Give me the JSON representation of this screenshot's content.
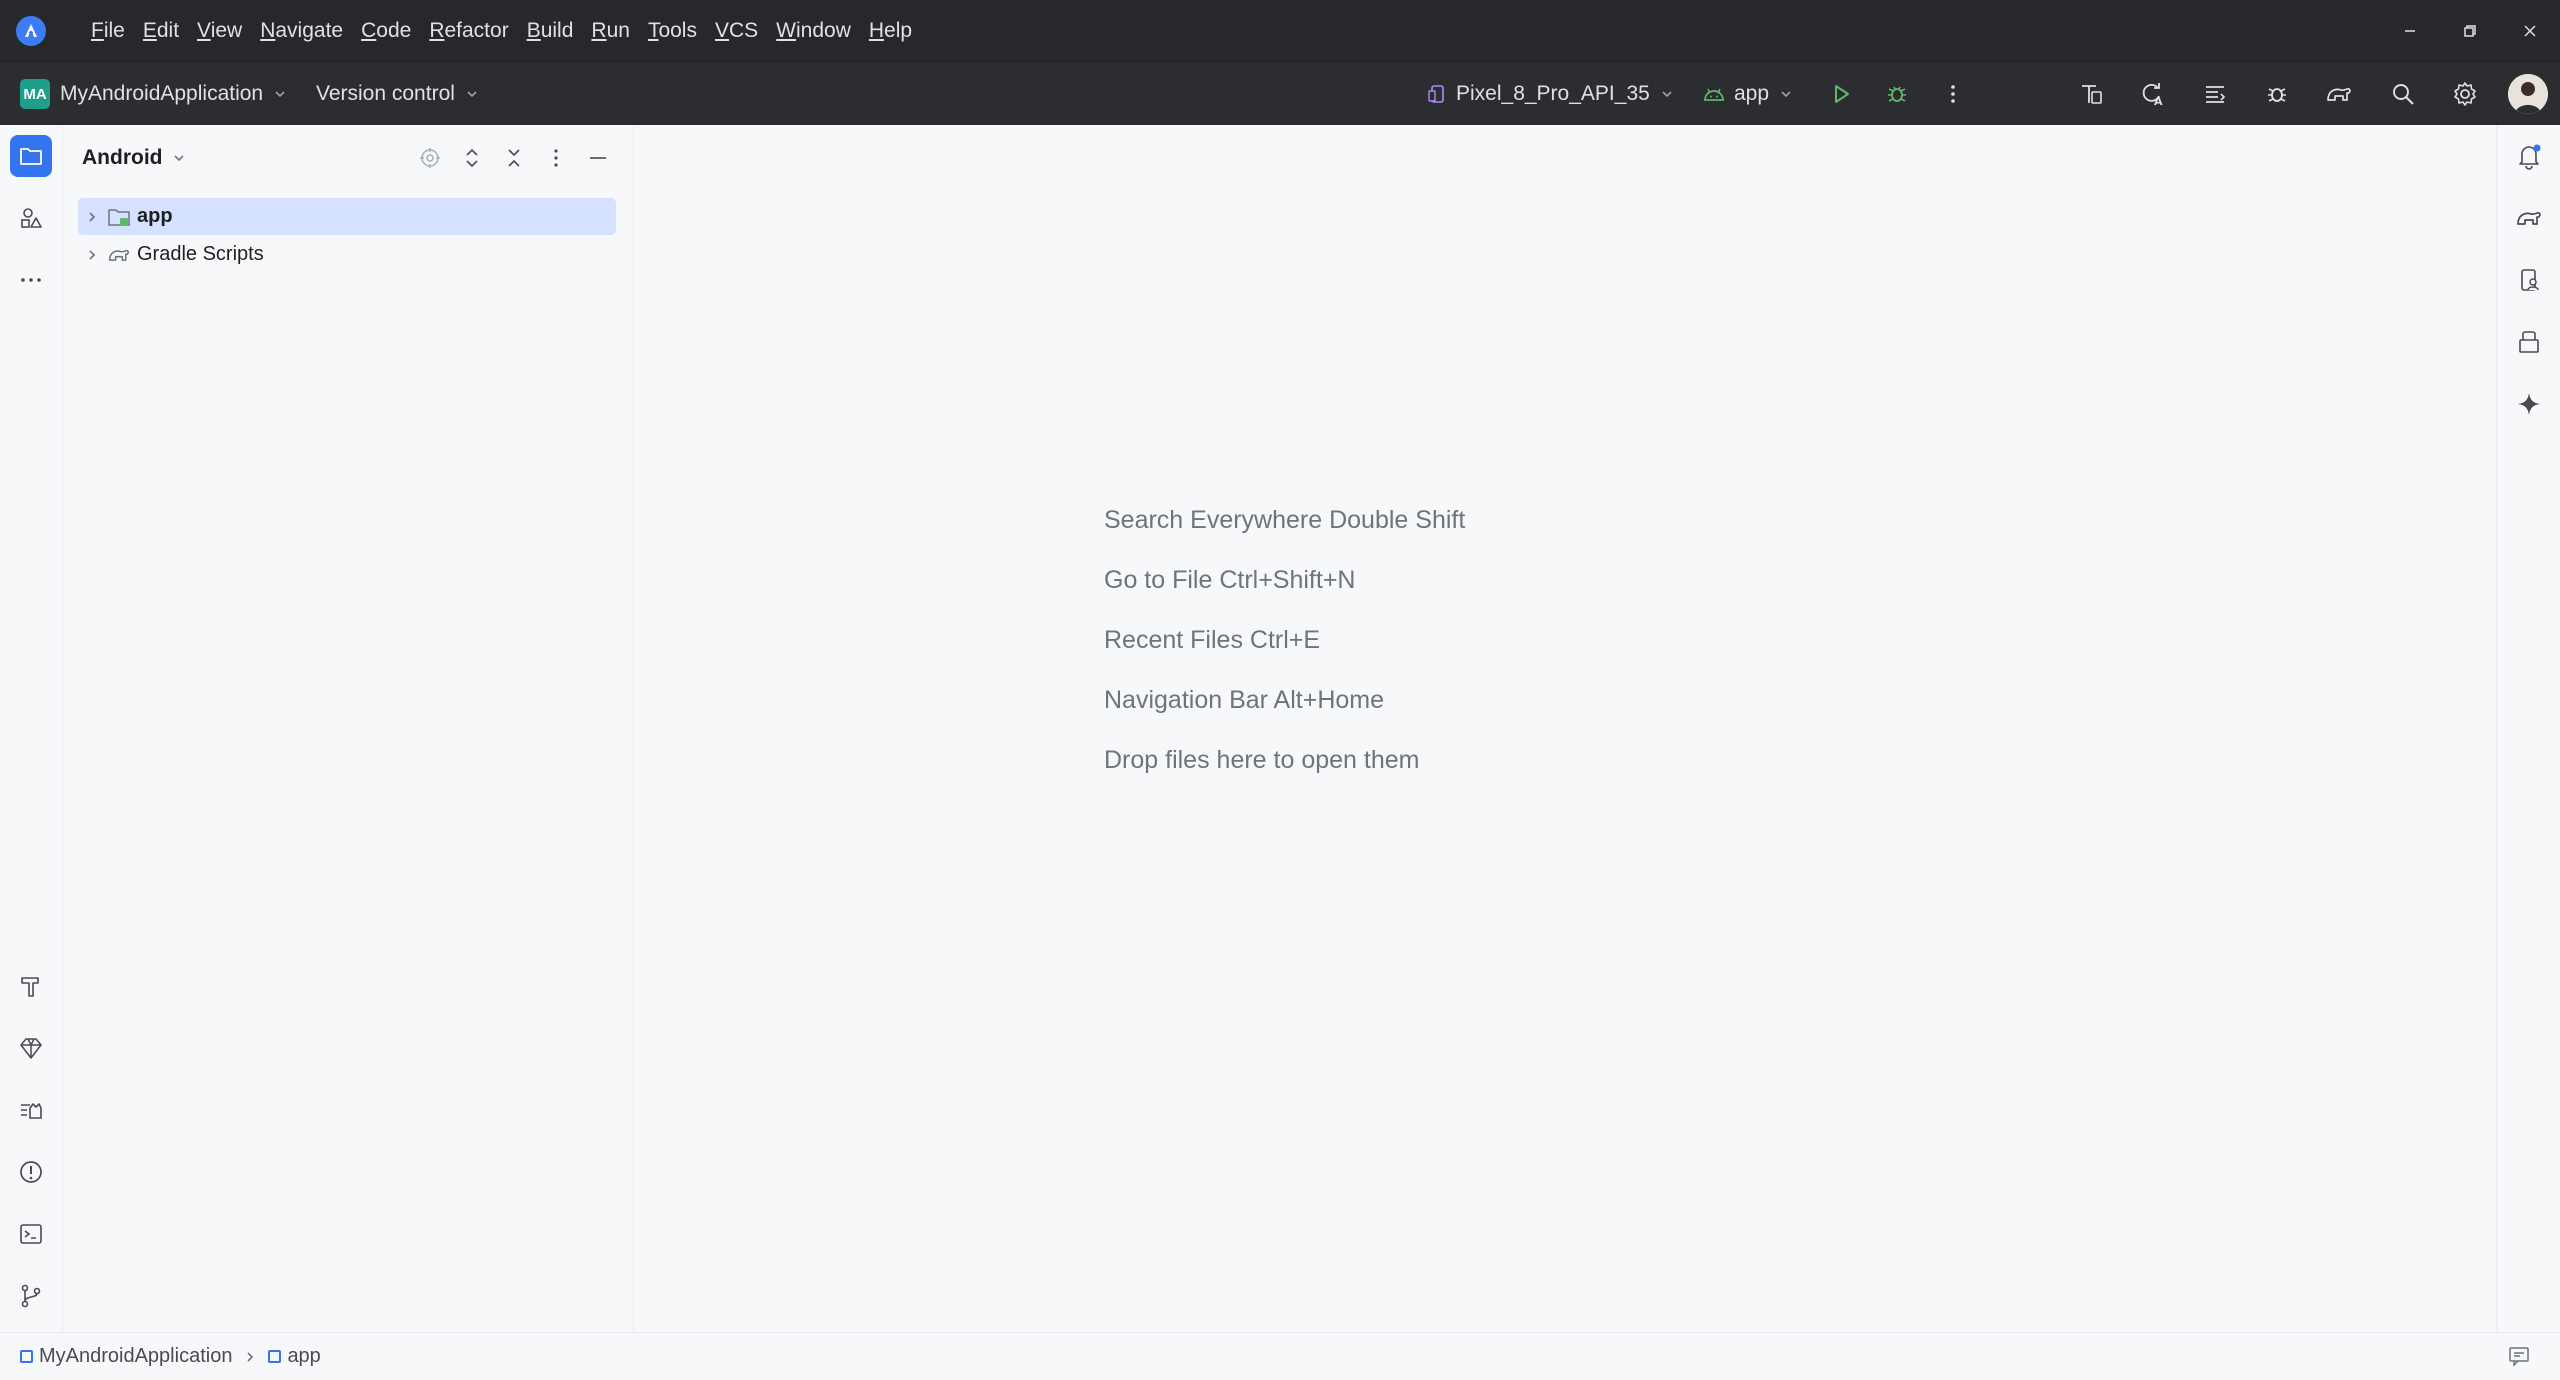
{
  "menubar": {
    "items": [
      "File",
      "Edit",
      "View",
      "Navigate",
      "Code",
      "Refactor",
      "Build",
      "Run",
      "Tools",
      "VCS",
      "Window",
      "Help"
    ]
  },
  "toolbar": {
    "project_badge": "MA",
    "project_name": "MyAndroidApplication",
    "vcs_label": "Version control",
    "device_name": "Pixel_8_Pro_API_35",
    "run_config": "app"
  },
  "project_panel": {
    "view_title": "Android",
    "tree": [
      {
        "label": "app",
        "selected": true,
        "bold": true,
        "icon": "module-folder-icon"
      },
      {
        "label": "Gradle Scripts",
        "selected": false,
        "bold": false,
        "icon": "gradle-elephant-icon"
      }
    ]
  },
  "editor": {
    "hints": [
      "Search Everywhere Double Shift",
      "Go to File Ctrl+Shift+N",
      "Recent Files Ctrl+E",
      "Navigation Bar Alt+Home",
      "Drop files here to open them"
    ]
  },
  "statusbar": {
    "breadcrumbs": [
      "MyAndroidApplication",
      "app"
    ]
  },
  "colors": {
    "accent": "#3574f0",
    "run_green": "#5fb865",
    "project_badge": "#1f9e8c",
    "selection": "#d5e1ff"
  }
}
